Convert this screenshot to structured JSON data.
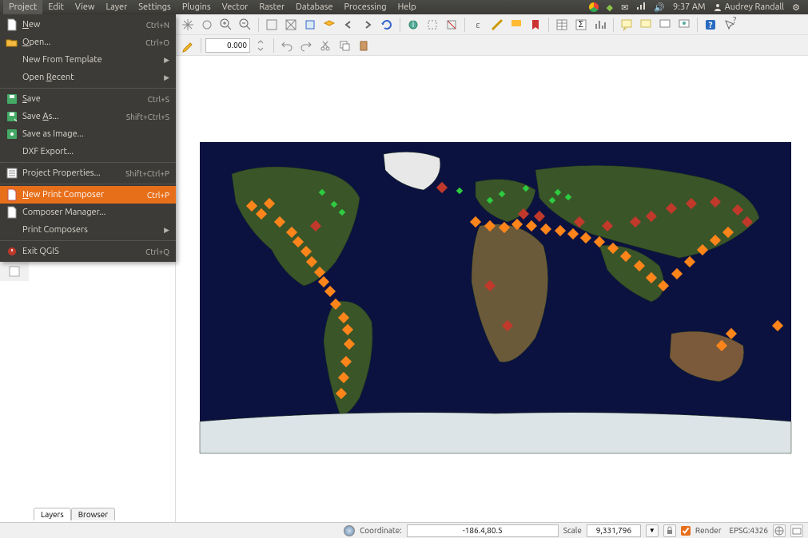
{
  "menubar": {
    "items": [
      "Project",
      "Edit",
      "View",
      "Layer",
      "Settings",
      "Plugins",
      "Vector",
      "Raster",
      "Database",
      "Processing",
      "Help"
    ]
  },
  "system": {
    "time": "9:37 AM",
    "user": "Audrey Randall"
  },
  "project_menu": {
    "items": [
      {
        "label": "New",
        "accel": "Ctrl+N",
        "icon": "file-blank-icon",
        "u": 0
      },
      {
        "label": "Open...",
        "accel": "Ctrl+O",
        "icon": "folder-open-icon",
        "u": 0
      },
      {
        "label": "New From Template",
        "submenu": true
      },
      {
        "label": "Open Recent",
        "submenu": true,
        "u": 5
      },
      {
        "sep": true
      },
      {
        "label": "Save",
        "accel": "Ctrl+S",
        "icon": "save-icon",
        "u": 0
      },
      {
        "label": "Save As...",
        "accel": "Shift+Ctrl+S",
        "icon": "save-as-icon",
        "u": 5
      },
      {
        "label": "Save as Image...",
        "icon": "save-image-icon"
      },
      {
        "label": "DXF Export..."
      },
      {
        "sep": true
      },
      {
        "label": "Project Properties...",
        "accel": "Shift+Ctrl+P",
        "icon": "properties-icon"
      },
      {
        "sep": true
      },
      {
        "label": "New Print Composer",
        "accel": "Ctrl+P",
        "icon": "composer-new-icon",
        "highlight": true,
        "u": 0
      },
      {
        "label": "Composer Manager...",
        "icon": "composer-manager-icon"
      },
      {
        "label": "Print Composers",
        "submenu": true
      },
      {
        "sep": true
      },
      {
        "label": "Exit QGIS",
        "accel": "Ctrl+Q",
        "icon": "exit-icon"
      }
    ]
  },
  "toolbar": {
    "rotation_value": "0.000"
  },
  "sidepanel": {
    "tabs": [
      {
        "label": "Layers",
        "active": true
      },
      {
        "label": "Browser",
        "active": false
      }
    ]
  },
  "statusbar": {
    "coord_label": "Coordinate:",
    "coord_value": "-186.4,80.5",
    "scale_label": "Scale",
    "scale_value": "9,331,796",
    "render_label": "Render",
    "crs_label": "EPSG:4326"
  }
}
